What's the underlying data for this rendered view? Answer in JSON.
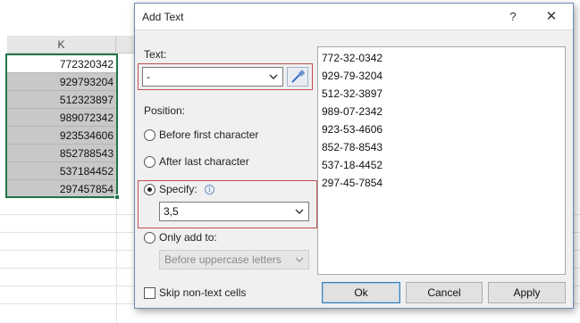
{
  "sheet": {
    "column_header": "K",
    "cells": [
      "772320342",
      "929793204",
      "512323897",
      "989072342",
      "923534606",
      "852788543",
      "537184452",
      "297457854"
    ]
  },
  "dialog": {
    "title": "Add Text",
    "help_label": "?",
    "close_label": "✕",
    "text_label": "Text:",
    "text_value": "-",
    "position_label": "Position:",
    "options": {
      "before_first": "Before first character",
      "after_last": "After last character",
      "specify": "Specify:",
      "only_add_to": "Only add to:"
    },
    "info_glyph": "i",
    "specify_value": "3,5",
    "only_add_value": "Before uppercase letters",
    "skip_label": "Skip non-text cells",
    "preview": [
      "772-32-0342",
      "929-79-3204",
      "512-32-3897",
      "989-07-2342",
      "923-53-4606",
      "852-78-8543",
      "537-18-4452",
      "297-45-7854"
    ],
    "buttons": {
      "ok": "Ok",
      "cancel": "Cancel",
      "apply": "Apply"
    },
    "selected_option": "specify",
    "icons": {
      "picker": "eyedropper-icon",
      "info": "info-icon",
      "dropdown": "chevron-down-icon"
    },
    "colors": {
      "highlight_box": "#c0504d",
      "selection": "#217346"
    }
  }
}
